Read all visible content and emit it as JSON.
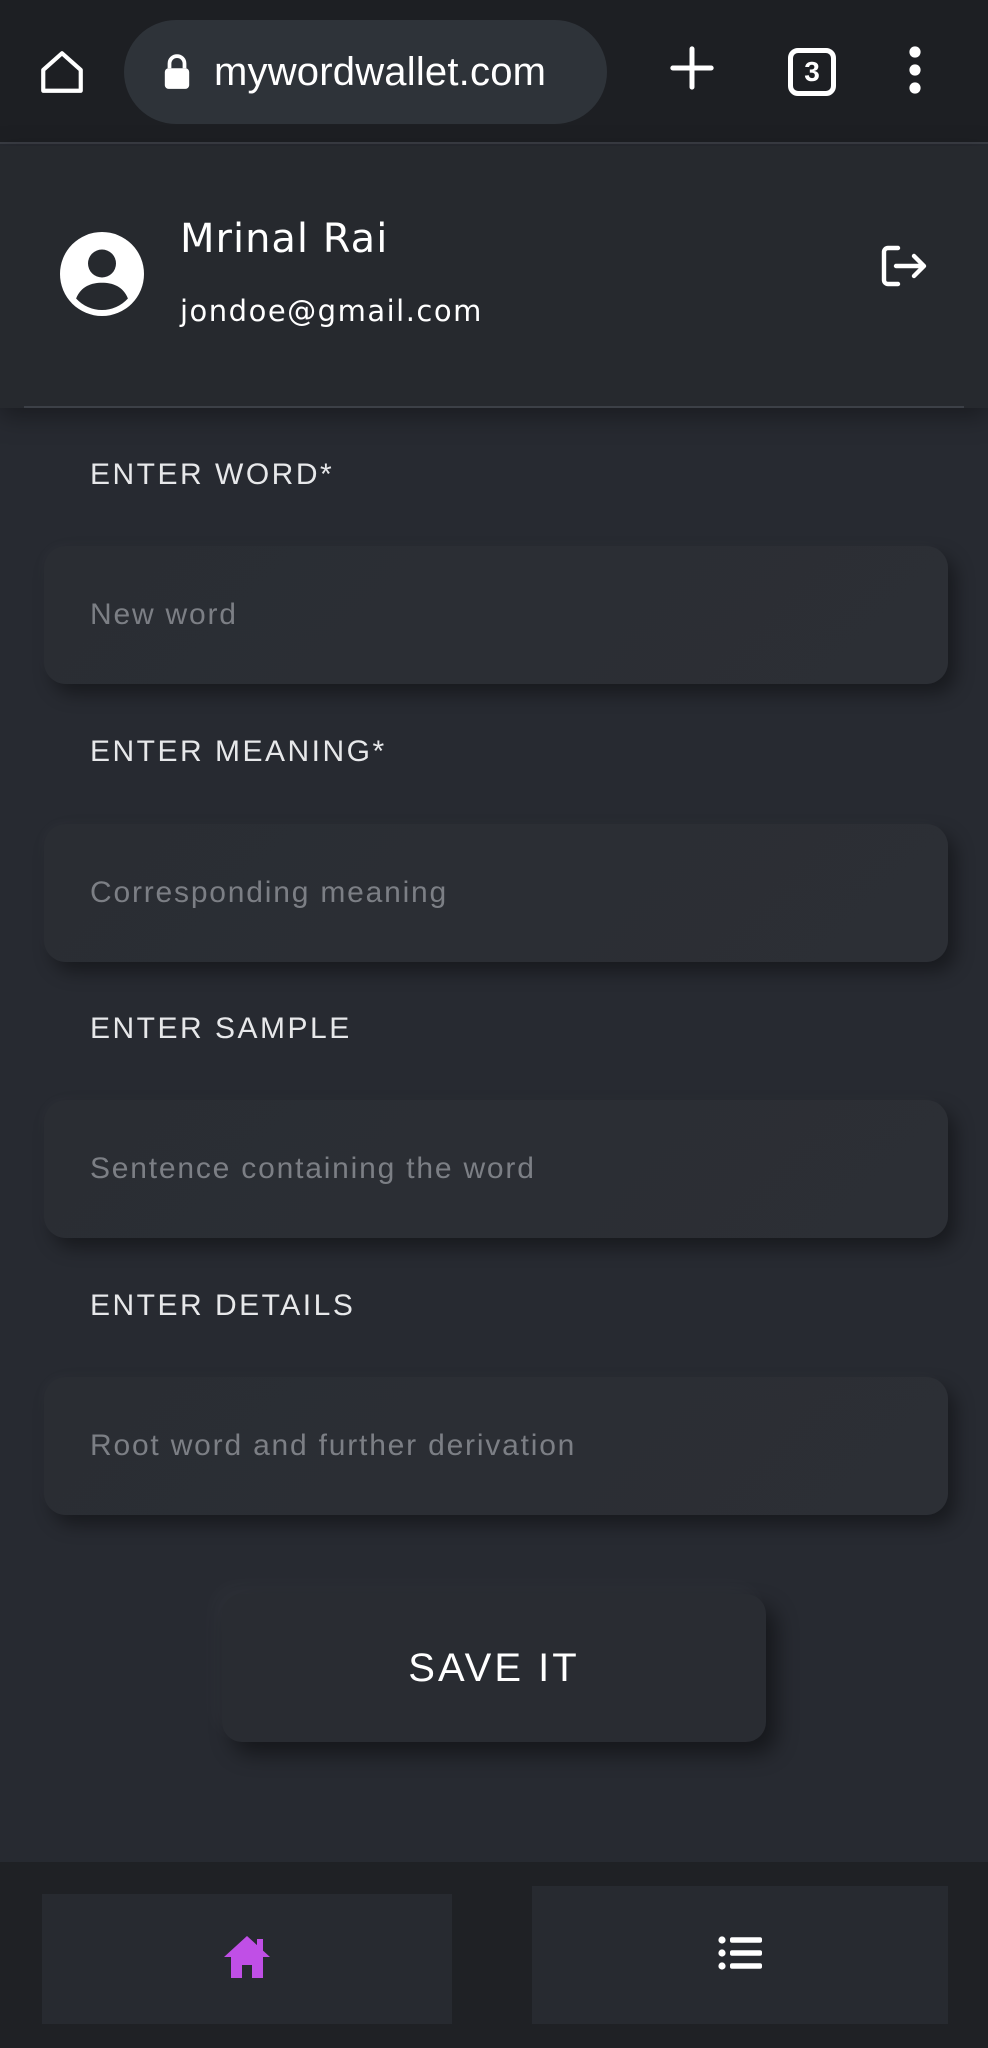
{
  "browser": {
    "url": "mywordwallet.com",
    "tab_count": "3",
    "icons": [
      "home-icon",
      "lock-icon",
      "plus-icon",
      "tab-switcher-icon",
      "more-vert-icon"
    ]
  },
  "profile": {
    "name": "Mrinal Rai",
    "email": "jondoe@gmail.com",
    "icons": [
      "account-circle-icon",
      "logout-icon"
    ]
  },
  "form": {
    "word": {
      "label": "ENTER WORD*",
      "placeholder": "New word",
      "value": ""
    },
    "meaning": {
      "label": "ENTER MEANING*",
      "placeholder": "Corresponding meaning",
      "value": ""
    },
    "sample": {
      "label": "ENTER SAMPLE",
      "placeholder": "Sentence containing the word",
      "value": ""
    },
    "details": {
      "label": "ENTER DETAILS",
      "placeholder": "Root word and further derivation",
      "value": ""
    },
    "save_label": "SAVE IT"
  },
  "bottom_nav": {
    "items": [
      {
        "icon": "home-icon",
        "active": true
      },
      {
        "icon": "list-icon",
        "active": false
      }
    ]
  },
  "colors": {
    "background": "#272a31",
    "chrome": "#1d1f23",
    "accent_active": "#c04fe6",
    "placeholder": "#7c7f85"
  }
}
